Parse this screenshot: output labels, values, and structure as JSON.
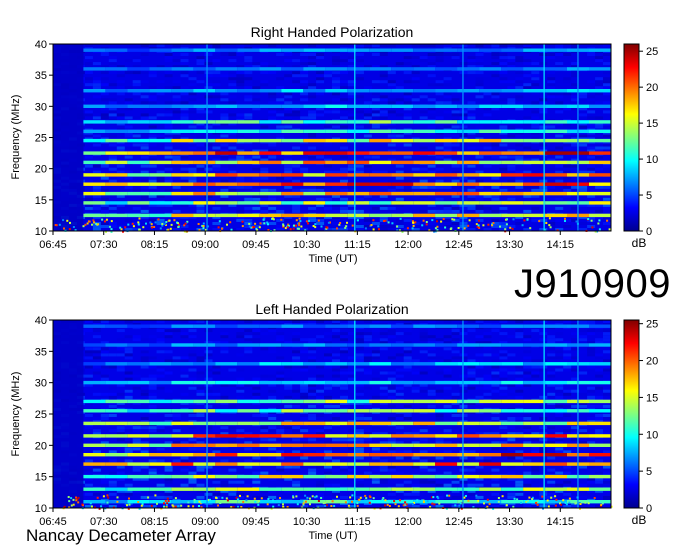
{
  "observation_id": "J910909",
  "instrument": "Nancay Decameter Array",
  "colors": {
    "colormap": [
      "#00008f",
      "#0000ff",
      "#00ffff",
      "#ffff00",
      "#ff0000",
      "#800000"
    ]
  },
  "chart_data": [
    {
      "type": "heatmap",
      "title": "Right Handed Polarization",
      "xlabel": "Time (UT)",
      "ylabel": "Frequency (MHz)",
      "x_ticks": [
        "06:45",
        "07:30",
        "08:15",
        "09:00",
        "09:45",
        "10:30",
        "11:15",
        "12:00",
        "12:45",
        "13:30",
        "14:15"
      ],
      "x_range_minutes": [
        405,
        900
      ],
      "ylim": [
        10,
        40
      ],
      "y_ticks": [
        10,
        15,
        20,
        25,
        30,
        35,
        40
      ],
      "colorbar": {
        "label": "dB",
        "range": [
          0,
          26
        ],
        "ticks": [
          0,
          5,
          10,
          15,
          20,
          25
        ]
      },
      "emission_bands_mhz": [
        {
          "freq": 12.5,
          "db": 18
        },
        {
          "freq": 14.5,
          "db": 16
        },
        {
          "freq": 16.0,
          "db": 20
        },
        {
          "freq": 17.5,
          "db": 24
        },
        {
          "freq": 19.0,
          "db": 22
        },
        {
          "freq": 21.0,
          "db": 20
        },
        {
          "freq": 22.5,
          "db": 24
        },
        {
          "freq": 24.5,
          "db": 18
        },
        {
          "freq": 26.0,
          "db": 12
        },
        {
          "freq": 27.5,
          "db": 14
        },
        {
          "freq": 30.0,
          "db": 10
        },
        {
          "freq": 32.5,
          "db": 9
        },
        {
          "freq": 36.0,
          "db": 8
        },
        {
          "freq": 39.0,
          "db": 8
        }
      ]
    },
    {
      "type": "heatmap",
      "title": "Left Handed Polarization",
      "xlabel": "Time (UT)",
      "ylabel": "Frequency (MHz)",
      "x_ticks": [
        "06:45",
        "07:30",
        "08:15",
        "09:00",
        "09:45",
        "10:30",
        "11:15",
        "12:00",
        "12:45",
        "13:30",
        "14:15"
      ],
      "x_range_minutes": [
        405,
        900
      ],
      "ylim": [
        10,
        40
      ],
      "y_ticks": [
        10,
        15,
        20,
        25,
        30,
        35,
        40
      ],
      "colorbar": {
        "label": "dB",
        "range": [
          0,
          25.5
        ],
        "ticks": [
          0,
          5,
          10,
          15,
          20,
          25
        ]
      },
      "emission_bands_mhz": [
        {
          "freq": 11.0,
          "db": 12
        },
        {
          "freq": 13.0,
          "db": 16
        },
        {
          "freq": 15.0,
          "db": 17
        },
        {
          "freq": 17.0,
          "db": 22
        },
        {
          "freq": 18.5,
          "db": 24
        },
        {
          "freq": 20.0,
          "db": 20
        },
        {
          "freq": 21.5,
          "db": 22
        },
        {
          "freq": 23.5,
          "db": 18
        },
        {
          "freq": 25.5,
          "db": 14
        },
        {
          "freq": 27.0,
          "db": 15
        },
        {
          "freq": 30.0,
          "db": 10
        },
        {
          "freq": 33.0,
          "db": 9
        },
        {
          "freq": 36.0,
          "db": 8
        },
        {
          "freq": 39.0,
          "db": 7
        }
      ]
    }
  ]
}
